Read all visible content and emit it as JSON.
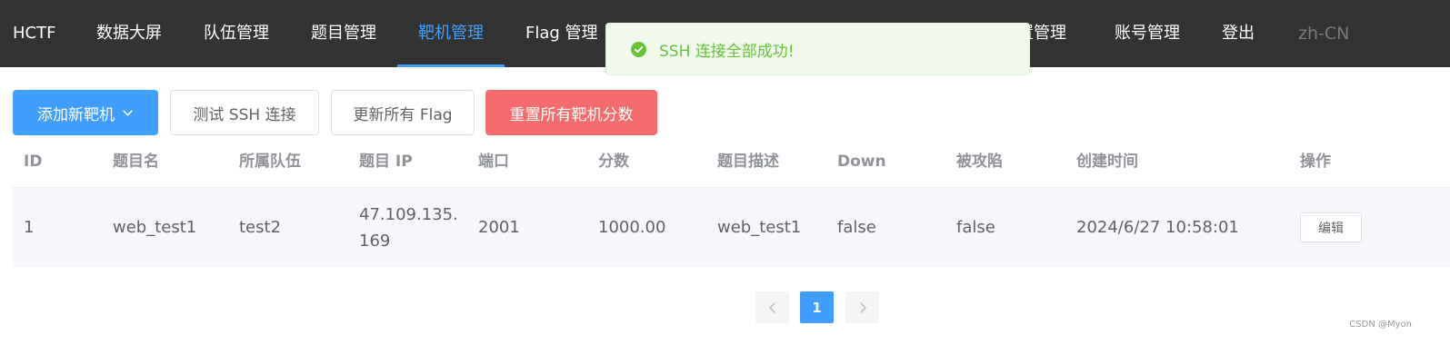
{
  "nav": {
    "brand": "HCTF",
    "items": [
      "数据大屏",
      "队伍管理",
      "题目管理",
      "靶机管理",
      "Flag 管理",
      "置管理",
      "账号管理",
      "登出"
    ],
    "active_index": 3,
    "language": "zh-CN"
  },
  "toast": {
    "type": "success",
    "icon": "check-circle-icon",
    "message": "SSH 连接全部成功!"
  },
  "toolbar": {
    "add_label": "添加新靶机",
    "test_ssh_label": "测试 SSH 连接",
    "refresh_flags_label": "更新所有 Flag",
    "reset_scores_label": "重置所有靶机分数"
  },
  "table": {
    "headers": [
      "ID",
      "题目名",
      "所属队伍",
      "题目 IP",
      "端口",
      "分数",
      "题目描述",
      "Down",
      "被攻陷",
      "创建时间",
      "操作"
    ],
    "rows": [
      {
        "id": "1",
        "name": "web_test1",
        "team": "test2",
        "ip": "47.109.135.169",
        "port": "2001",
        "score": "1000.00",
        "description": "web_test1",
        "down": "false",
        "captured": "false",
        "created_at": "2024/6/27 10:58:01",
        "action_label": "编辑"
      }
    ]
  },
  "pagination": {
    "current_page": "1"
  },
  "watermark": "CSDN @Myon⁠",
  "colors": {
    "nav_bg": "#333333",
    "accent": "#409eff",
    "danger": "#f56c6c",
    "success": "#67c23a"
  }
}
